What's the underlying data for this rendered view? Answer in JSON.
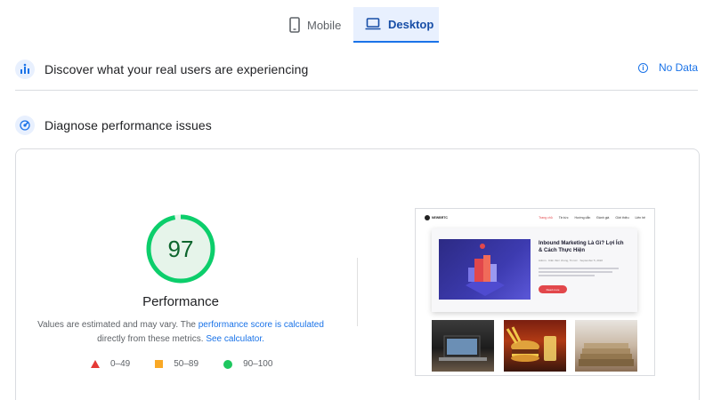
{
  "tabs": [
    {
      "label": "Mobile",
      "icon": "phone-icon",
      "active": false
    },
    {
      "label": "Desktop",
      "icon": "laptop-icon",
      "active": true
    }
  ],
  "real_users": {
    "title": "Discover what your real users are experiencing",
    "icon": "users-chart-icon",
    "no_data_label": "No Data"
  },
  "diagnose": {
    "title": "Diagnose performance issues",
    "icon": "diagnose-icon"
  },
  "performance": {
    "score": "97",
    "score_fraction": 0.97,
    "label": "Performance",
    "desc_part1": "Values are estimated and may vary. The ",
    "desc_link1": "performance score is calculated",
    "desc_part2": " directly from these metrics. ",
    "desc_link2": "See calculator."
  },
  "legend": [
    {
      "range": "0–49",
      "shape": "triangle",
      "color": "#e53935"
    },
    {
      "range": "50–89",
      "shape": "square",
      "color": "#f9a825"
    },
    {
      "range": "90–100",
      "shape": "circle",
      "color": "#1ec75f"
    }
  ],
  "colors": {
    "accent": "#1a73e8",
    "pass": "#0cce6b",
    "pass_bg": "#e6f4ea"
  },
  "thumbnail": {
    "site_logo": "NEWBRTC",
    "nav": [
      "Trang chủ",
      "Tin tức",
      "Hướng dẫn",
      "Đánh giá",
      "Giới thiệu",
      "Liên hệ"
    ],
    "headline": "Inbound Marketing Là Gì? Lợi Ích & Cách Thực Hiện",
    "meta": "Admin · Kiến thức chung, Tin tức · September 5, 2022",
    "button": "Read more"
  }
}
